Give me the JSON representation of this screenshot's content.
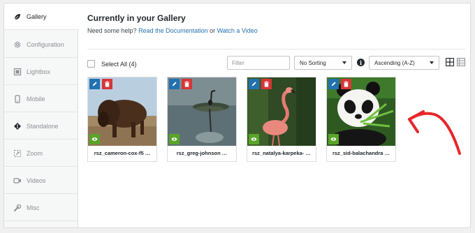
{
  "sidebar": {
    "items": [
      {
        "label": "Gallery",
        "icon": "leaf-icon"
      },
      {
        "label": "Configuration",
        "icon": "gear-icon"
      },
      {
        "label": "Lightbox",
        "icon": "lightbox-icon"
      },
      {
        "label": "Mobile",
        "icon": "mobile-icon"
      },
      {
        "label": "Standalone",
        "icon": "standalone-icon"
      },
      {
        "label": "Zoom",
        "icon": "zoom-icon"
      },
      {
        "label": "Videos",
        "icon": "video-icon"
      },
      {
        "label": "Misc",
        "icon": "wrench-icon"
      }
    ]
  },
  "main": {
    "title": "Currently in your Gallery",
    "help_prefix": "Need some help?",
    "doc_link": "Read the Documentation",
    "help_or": "or",
    "video_link": "Watch a Video"
  },
  "toolbar": {
    "select_all": "Select All (4)",
    "filter_placeholder": "Filter",
    "sorting": "No Sorting",
    "order": "Ascending (A-Z)"
  },
  "gallery": [
    {
      "caption": "rsz_cameron-cox-f5 …",
      "subject": "bison"
    },
    {
      "caption": "rsz_greg-johnson …",
      "subject": "heron"
    },
    {
      "caption": "rsz_natalya-karpeka- …",
      "subject": "flamingo"
    },
    {
      "caption": "rsz_sid-balachandra …",
      "subject": "panda"
    }
  ],
  "colors": {
    "accent_link": "#2271b1",
    "edit_button": "#2271b1",
    "delete_button": "#d63638",
    "view_button": "#5aa42a",
    "annotation_arrow": "#e8262a"
  }
}
